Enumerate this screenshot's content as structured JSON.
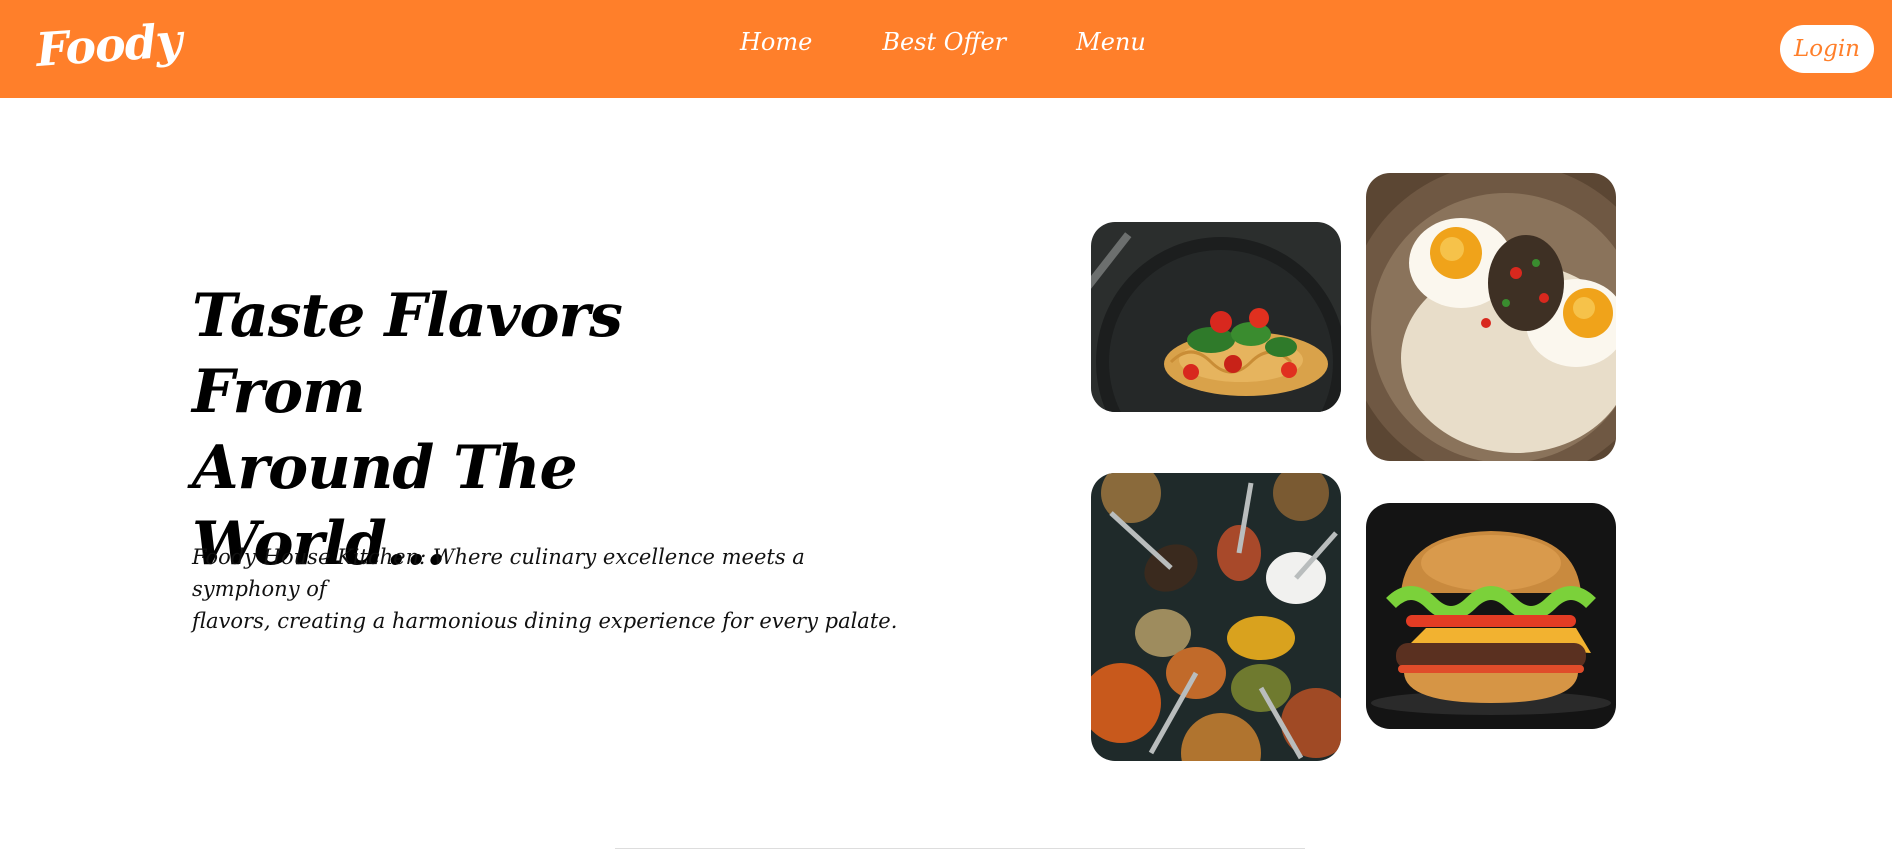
{
  "brand": {
    "logo_text": "Foody",
    "accent_color": "#ff7f2a"
  },
  "nav": {
    "links": [
      {
        "label": "Home"
      },
      {
        "label": "Best Offer"
      },
      {
        "label": "Menu"
      }
    ],
    "login_label": "Login"
  },
  "hero": {
    "title_line1": "Taste Flavors From",
    "title_line2": "Around The",
    "title_line3": "World...",
    "description_line1": "Foody House Kitchen: Where culinary excellence meets a symphony of",
    "description_line2": "flavors, creating a harmonious dining experience for every palate."
  },
  "gallery": {
    "images": [
      {
        "icon": "pasta-dish-image"
      },
      {
        "icon": "fried-eggs-dish-image"
      },
      {
        "icon": "spices-image"
      },
      {
        "icon": "burger-image"
      }
    ]
  }
}
